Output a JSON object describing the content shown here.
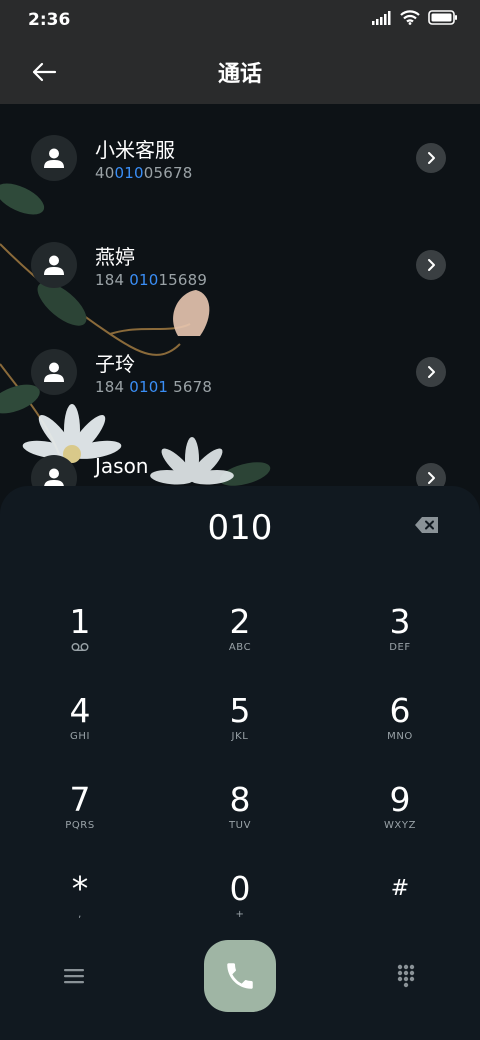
{
  "status_bar": {
    "time": "2:36"
  },
  "header": {
    "title": "通话"
  },
  "contacts": [
    {
      "name": "小米客服",
      "number_pre": "40",
      "number_hl": "010",
      "number_post": "05678"
    },
    {
      "name": "燕婷",
      "number_pre": "184 ",
      "number_hl": "010",
      "number_post": "15689"
    },
    {
      "name": "子玲",
      "number_pre": "184 ",
      "number_hl": "0101",
      "number_post": " 5678"
    },
    {
      "name": "Jason",
      "number_pre": "",
      "number_hl": "",
      "number_post": ""
    }
  ],
  "dialer": {
    "display": "010",
    "keys": [
      {
        "digit": "1",
        "sub": ""
      },
      {
        "digit": "2",
        "sub": "ABC"
      },
      {
        "digit": "3",
        "sub": "DEF"
      },
      {
        "digit": "4",
        "sub": "GHI"
      },
      {
        "digit": "5",
        "sub": "JKL"
      },
      {
        "digit": "6",
        "sub": "MNO"
      },
      {
        "digit": "7",
        "sub": "PQRS"
      },
      {
        "digit": "8",
        "sub": "TUV"
      },
      {
        "digit": "9",
        "sub": "WXYZ"
      },
      {
        "digit": "*",
        "sub": ","
      },
      {
        "digit": "0",
        "sub": "+"
      },
      {
        "digit": "#",
        "sub": ""
      }
    ]
  },
  "icons": {
    "back": "back-arrow-icon",
    "backspace": "backspace-icon",
    "menu": "menu-icon",
    "call": "phone-icon",
    "keypad": "keypad-icon",
    "voicemail": "voicemail-icon"
  },
  "colors": {
    "highlight": "#3a8ef6",
    "call_button": "#9fb5a4"
  }
}
